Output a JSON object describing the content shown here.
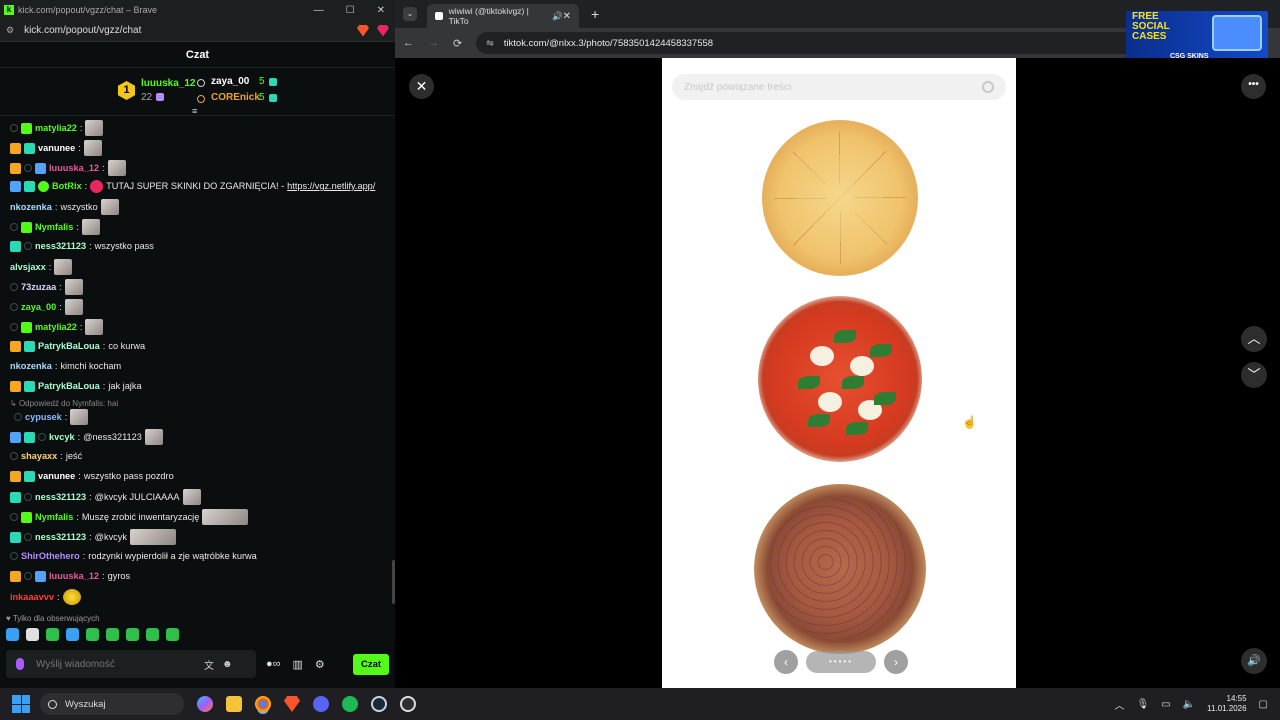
{
  "chat_window": {
    "title": "kick.com/popout/vgzz/chat – Brave",
    "url": "kick.com/popout/vgzz/chat",
    "header": "Czat",
    "leaderboard": {
      "first": {
        "rank": "1",
        "name": "luuuska_12",
        "count": "22"
      },
      "second": {
        "name": "zaya_00",
        "count": "5"
      },
      "third": {
        "name": "COREnick",
        "count": "5"
      }
    },
    "messages": [
      {
        "user": "matylia22",
        "text": "",
        "color": "#53fc18"
      },
      {
        "user": "vanunee",
        "text": "",
        "color": "#ffffff"
      },
      {
        "user": "luuuska_12",
        "text": "",
        "color": "#e8579c"
      },
      {
        "user": "BotRix",
        "text": "TUTAJ SUPER SKINKI DO ZGARNIĘCIA! -",
        "link": "https://vgz.netlify.app/",
        "color": "#53fc18"
      },
      {
        "user": "nkozenka",
        "text": "wszystko",
        "color": "#a8dcff"
      },
      {
        "user": "Nymfalis",
        "text": "",
        "color": "#53fc18"
      },
      {
        "user": "ness321123",
        "text": "wszystko pass",
        "color": "#a8ffce"
      },
      {
        "user": "alvsjaxx",
        "text": "",
        "color": "#a8ffce"
      },
      {
        "user": "73zuzaa",
        "text": "",
        "color": "#d8d8ff"
      },
      {
        "user": "zaya_00",
        "text": "",
        "color": "#53fc18"
      },
      {
        "user": "matylia22",
        "text": "",
        "color": "#53fc18"
      },
      {
        "user": "PatrykBaLoua",
        "text": "co kurwa",
        "color": "#a8ffce"
      },
      {
        "user": "nkozenka",
        "text": "kimchi kocham",
        "color": "#a8dcff"
      },
      {
        "user": "PatrykBaLoua",
        "text": "jak jajka",
        "color": "#a8ffce"
      },
      {
        "reply": "Odpowiedź do Nymfalis: hai"
      },
      {
        "user": "cypusek",
        "text": "",
        "color": "#8fb9ff"
      },
      {
        "user": "kvcyk",
        "text": "@ness321123",
        "color": "#a8ffce"
      },
      {
        "user": "shayaxx",
        "text": "jeść",
        "color": "#ffd36e"
      },
      {
        "user": "vanunee",
        "text": "wszystko pass pozdro",
        "color": "#ffffff"
      },
      {
        "user": "ness321123",
        "text": "@kvcyk JULCIAAAA",
        "color": "#a8ffce"
      },
      {
        "user": "Nymfalis",
        "text": "Muszę zrobić inwentaryzację",
        "color": "#53fc18"
      },
      {
        "user": "ness321123",
        "text": "@kvcyk",
        "color": "#a8ffce"
      },
      {
        "user": "ShirOthehero",
        "text": "rodzynki wypierdolił a zje wątróbke kurwa",
        "color": "#b48cff"
      },
      {
        "user": "luuuska_12",
        "text": "gyros",
        "color": "#e8579c"
      },
      {
        "user": "inkaaavvv",
        "text": "",
        "color": "#ff3b3b"
      }
    ],
    "followers_only": "Tylko dla obserwujących",
    "input_placeholder": "Wyślij wiadomość",
    "send_label": "Czat"
  },
  "browser": {
    "tab_title": "wiwiwi (@tiktokivgz) | TikTo",
    "url": "tiktok.com/@nlxx.3/photo/7583501424458337558",
    "ad": {
      "headline_1": "FREE",
      "headline_2": "SOCIAL",
      "headline_3": "CASES",
      "brand": "CSG SKINS"
    },
    "related_search_placeholder": "Znajdź powiązane treści",
    "carousel_dots": "•••••"
  },
  "taskbar": {
    "search_label": "Wyszukaj",
    "time": "14:55",
    "date": "11.01.2026"
  }
}
